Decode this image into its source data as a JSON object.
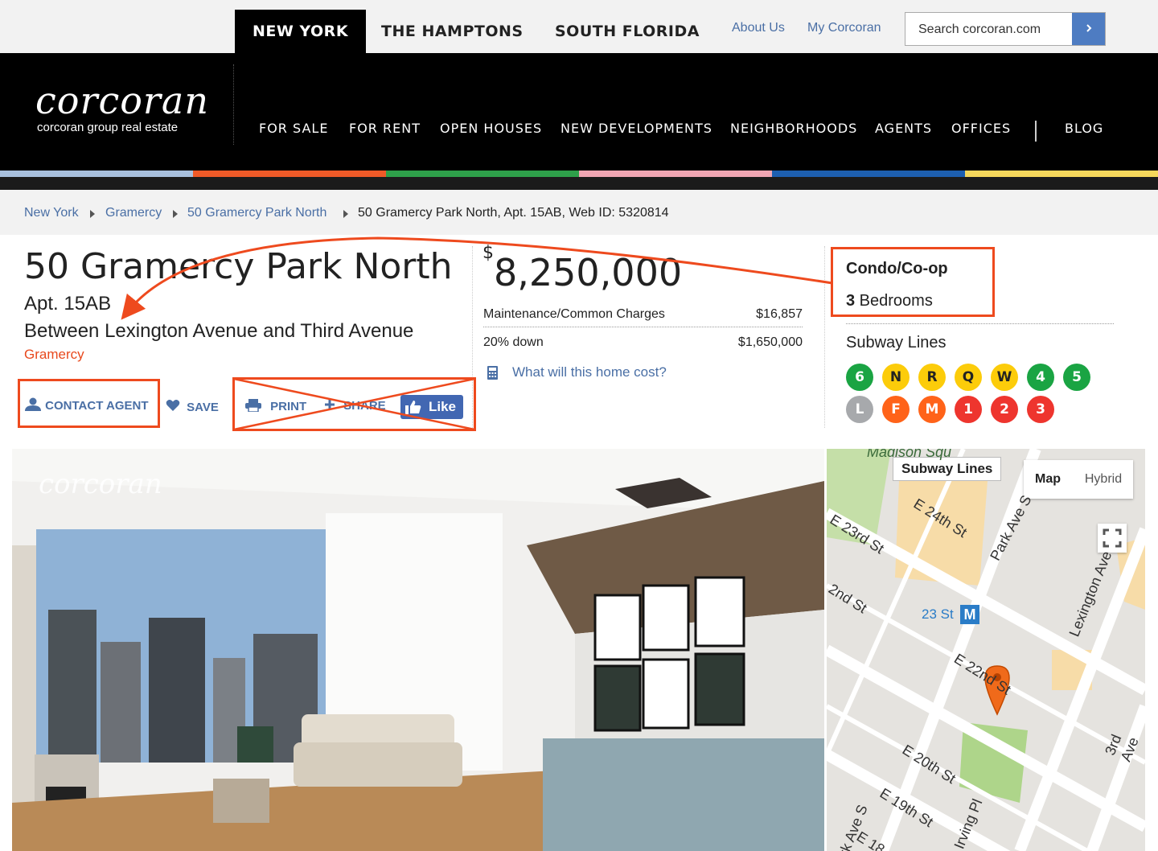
{
  "regions": [
    {
      "label": "NEW YORK",
      "active": true
    },
    {
      "label": "THE HAMPTONS",
      "active": false
    },
    {
      "label": "SOUTH FLORIDA",
      "active": false
    }
  ],
  "toplinks": {
    "about": "About Us",
    "my": "My Corcoran"
  },
  "search": {
    "placeholder": "Search corcoran.com"
  },
  "logo": {
    "wordmark": "corcoran",
    "tagline": "corcoran group real estate"
  },
  "nav": [
    "FOR SALE",
    "FOR RENT",
    "OPEN HOUSES",
    "NEW DEVELOPMENTS",
    "NEIGHBORHOODS",
    "AGENTS",
    "OFFICES",
    "BLOG"
  ],
  "stripe_colors": [
    "#a8c0dd",
    "#ef5a28",
    "#2ea04a",
    "#f0a6b3",
    "#1d5fb0",
    "#f5d75c"
  ],
  "breadcrumb": [
    "New York",
    "Gramercy",
    "50 Gramercy Park North",
    "50 Gramercy Park North, Apt. 15AB, Web ID: 5320814"
  ],
  "listing": {
    "title": "50 Gramercy Park North",
    "apt": "Apt. 15AB",
    "between": "Between Lexington Avenue and Third Avenue",
    "neighborhood": "Gramercy",
    "price_symbol": "$",
    "price": "8,250,000",
    "maintenance_label": "Maintenance/Common Charges",
    "maintenance_value": "$16,857",
    "down_label": "20% down",
    "down_value": "$1,650,000",
    "cost_link": "What will this home cost?",
    "type": "Condo/Co-op",
    "beds_count": "3",
    "beds_label": " Bedrooms",
    "subway_heading": "Subway Lines"
  },
  "actions": {
    "contact": "CONTACT AGENT",
    "save": "SAVE",
    "print": "PRINT",
    "share": "SHARE",
    "like": "Like"
  },
  "subway_lines": [
    {
      "label": "6",
      "color": "#1aa443"
    },
    {
      "label": "N",
      "color": "#fccc0a",
      "text": "#222"
    },
    {
      "label": "R",
      "color": "#fccc0a",
      "text": "#222"
    },
    {
      "label": "Q",
      "color": "#fccc0a",
      "text": "#222"
    },
    {
      "label": "W",
      "color": "#fccc0a",
      "text": "#222"
    },
    {
      "label": "4",
      "color": "#1aa443"
    },
    {
      "label": "5",
      "color": "#1aa443"
    },
    {
      "label": "L",
      "color": "#a7a9ac"
    },
    {
      "label": "F",
      "color": "#ff6319"
    },
    {
      "label": "M",
      "color": "#ff6319"
    },
    {
      "label": "1",
      "color": "#ee352e"
    },
    {
      "label": "2",
      "color": "#ee352e"
    },
    {
      "label": "3",
      "color": "#ee352e"
    }
  ],
  "photo": {
    "watermark": "corcoran"
  },
  "map": {
    "subway_lines_label": "Subway Lines",
    "map_btn": "Map",
    "hybrid_btn": "Hybrid",
    "station": "23 St",
    "station_icon": "M",
    "streets": [
      "Madison Squ",
      "E 24th St",
      "E 23rd St",
      "2nd St",
      "Park Ave S",
      "Lexington Ave",
      "E 22nd St",
      "E 20th St",
      "E 19th St",
      "3rd Ave",
      "Irving Pl",
      "rk Ave S",
      "E 18"
    ]
  },
  "accent": "#ee4a1e"
}
